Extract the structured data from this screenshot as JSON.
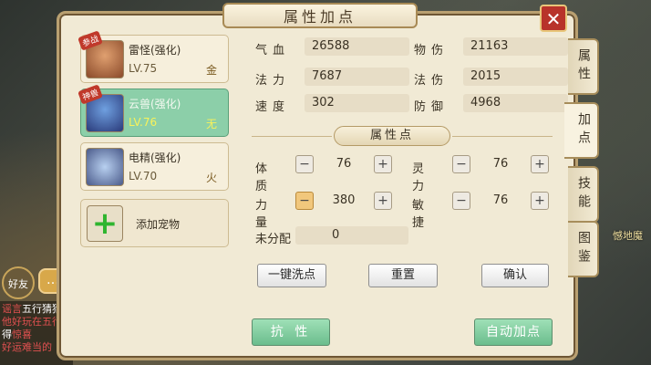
{
  "window": {
    "title": "属性加点",
    "close_label": "✕"
  },
  "pets": [
    {
      "name": "雷怪(强化)",
      "level": "LV.75",
      "element": "金",
      "badge": "参战",
      "selected": false
    },
    {
      "name": "云兽(强化)",
      "level": "LV.76",
      "element": "无",
      "badge": "神兽",
      "selected": true
    },
    {
      "name": "电精(强化)",
      "level": "LV.70",
      "element": "火",
      "badge": "",
      "selected": false
    }
  ],
  "add_pet": {
    "label": "添加宠物",
    "icon": "plus-icon"
  },
  "stats": [
    {
      "label": "气血",
      "value": "26588"
    },
    {
      "label": "物伤",
      "value": "21163"
    },
    {
      "label": "法力",
      "value": "7687"
    },
    {
      "label": "法伤",
      "value": "2015"
    },
    {
      "label": "速度",
      "value": "302"
    },
    {
      "label": "防御",
      "value": "4968"
    }
  ],
  "points_section": {
    "title": "属性点"
  },
  "attributes": [
    {
      "label": "体质",
      "value": "76"
    },
    {
      "label": "灵力",
      "value": "76"
    },
    {
      "label": "力量",
      "value": "380"
    },
    {
      "label": "敏捷",
      "value": "76"
    }
  ],
  "unassigned": {
    "label": "未分配",
    "value": "0"
  },
  "buttons": {
    "reset_all": "一键洗点",
    "reset": "重置",
    "confirm": "确认",
    "resist": "抗 性",
    "auto_assign": "自动加点"
  },
  "tabs": [
    {
      "label": "属性",
      "active": false
    },
    {
      "label": "加点",
      "active": true
    },
    {
      "label": "技能",
      "active": false
    },
    {
      "label": "图鉴",
      "active": false
    }
  ],
  "chat": {
    "lines": [
      {
        "text": "五行猜猜",
        "tag": "谣言"
      },
      {
        "text": "他好玩在五行",
        "tag": ""
      },
      {
        "text": "得",
        "tag": "惊喜"
      },
      {
        "text": "好运难当的",
        "tag": ""
      }
    ],
    "friend_label": "好友"
  },
  "scene": {
    "right_label": "憾地魔"
  }
}
